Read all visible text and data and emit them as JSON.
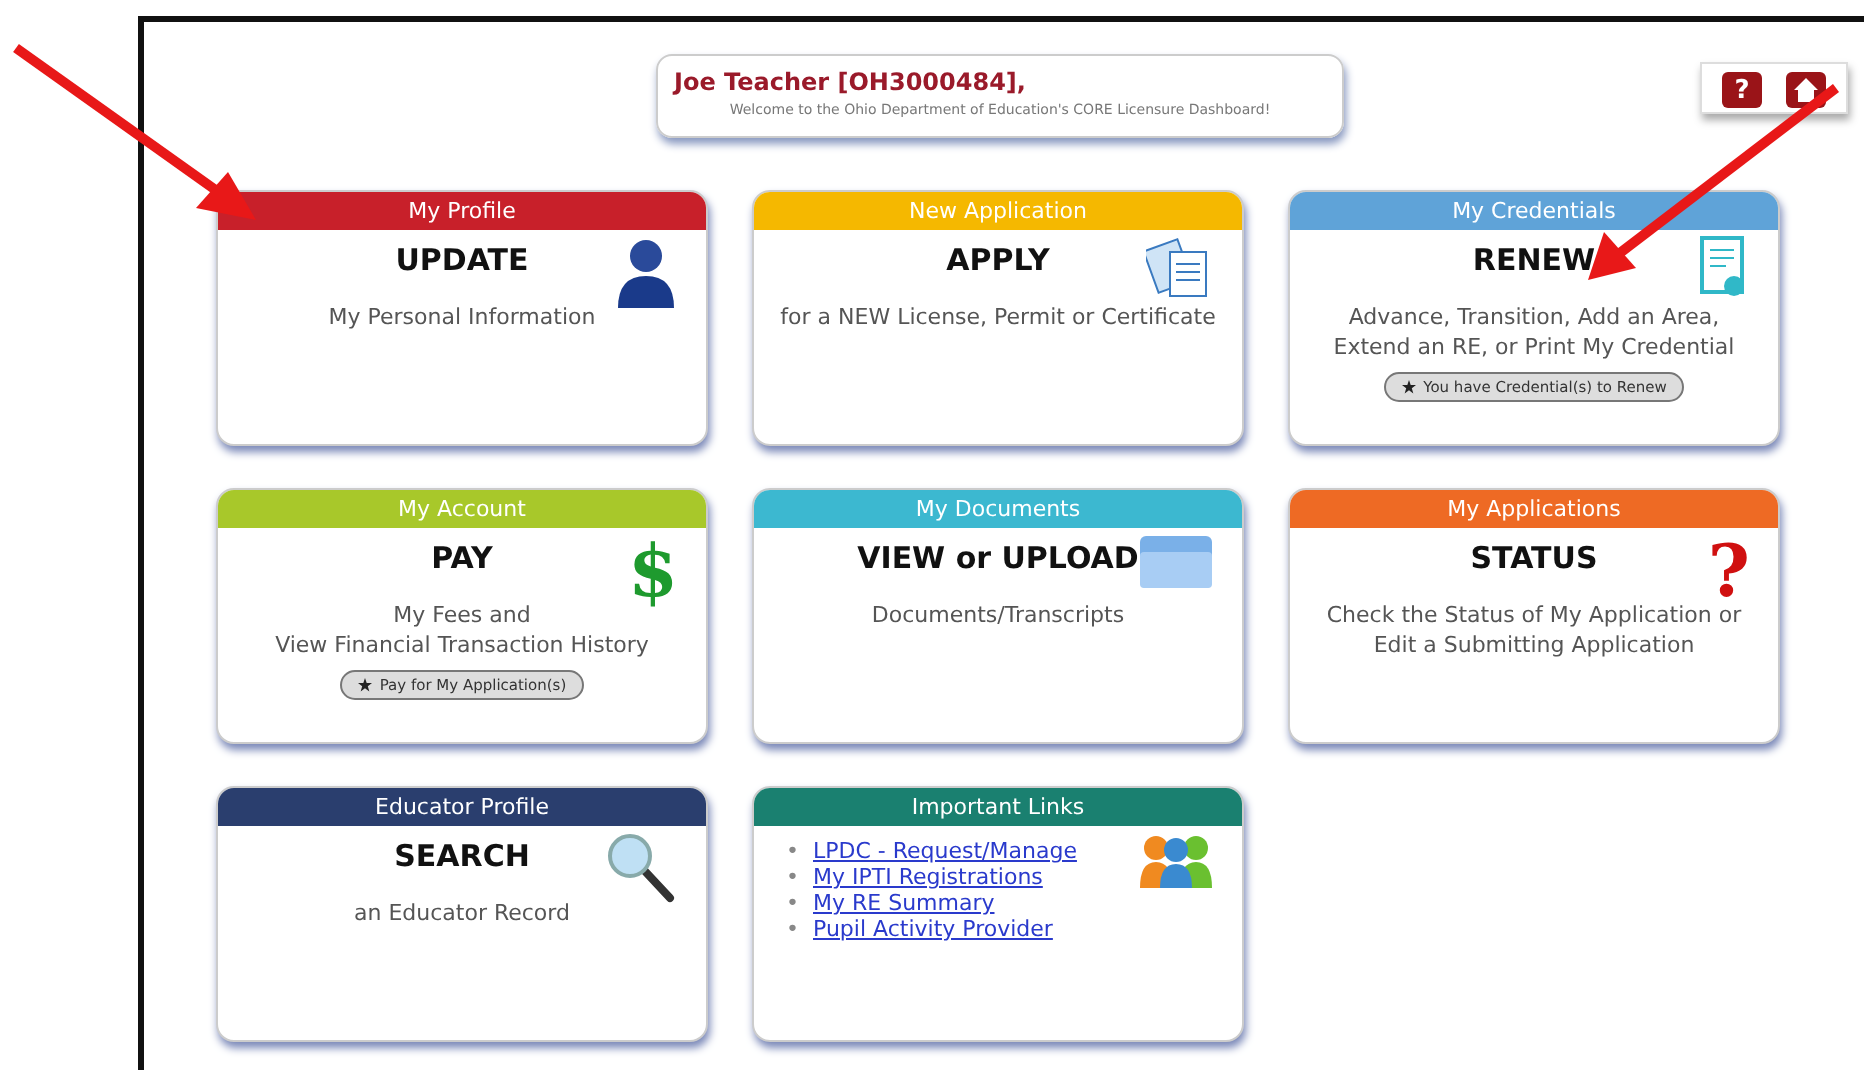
{
  "welcome": {
    "name": "Joe Teacher [OH3000484],",
    "message": "Welcome to the Ohio Department of Education's CORE Licensure Dashboard!"
  },
  "toolbar": [
    {
      "kind": "help",
      "label": "?"
    },
    {
      "kind": "home"
    }
  ],
  "cards": [
    {
      "kind": "action",
      "header": "My Profile",
      "color": "#c8202a",
      "title": "UPDATE",
      "description": [
        "My Personal Information"
      ]
    },
    {
      "kind": "action",
      "header": "New Application",
      "color": "#f5b800",
      "title": "APPLY",
      "description": [
        "for a NEW License, Permit or Certificate"
      ]
    },
    {
      "kind": "action",
      "header": "My Credentials",
      "color": "#5fa3d8",
      "title": "RENEW",
      "description": [
        "Advance, Transition, Add an Area,",
        "Extend an RE, or Print My Credential"
      ],
      "pill": "You have Credential(s) to Renew"
    },
    {
      "kind": "action",
      "header": "My Account",
      "color": "#a8c82a",
      "title": "PAY",
      "glyph": "$",
      "description": [
        "My Fees and",
        "View Financial Transaction History"
      ],
      "pill": "Pay for My Application(s)"
    },
    {
      "kind": "action",
      "header": "My Documents",
      "color": "#3cb8d0",
      "title": "VIEW or UPLOAD",
      "description": [
        "Documents/Transcripts"
      ]
    },
    {
      "kind": "action",
      "header": "My Applications",
      "color": "#ee6a24",
      "title": "STATUS",
      "glyph": "?",
      "description": [
        "Check the Status of My Application or",
        "Edit a Submitting Application"
      ]
    },
    {
      "kind": "action",
      "header": "Educator Profile",
      "color": "#2a3e6e",
      "title": "SEARCH",
      "description": [
        "an Educator Record"
      ]
    },
    {
      "kind": "links",
      "header": "Important Links",
      "color": "#1a8070",
      "links": [
        {
          "bullet": "•",
          "label": "LPDC - Request/Manage"
        },
        {
          "bullet": "•",
          "label": "My IPTI Registrations"
        },
        {
          "bullet": "•",
          "label": "My RE Summary"
        },
        {
          "bullet": "•",
          "label": "Pupil Activity Provider"
        }
      ]
    }
  ]
}
